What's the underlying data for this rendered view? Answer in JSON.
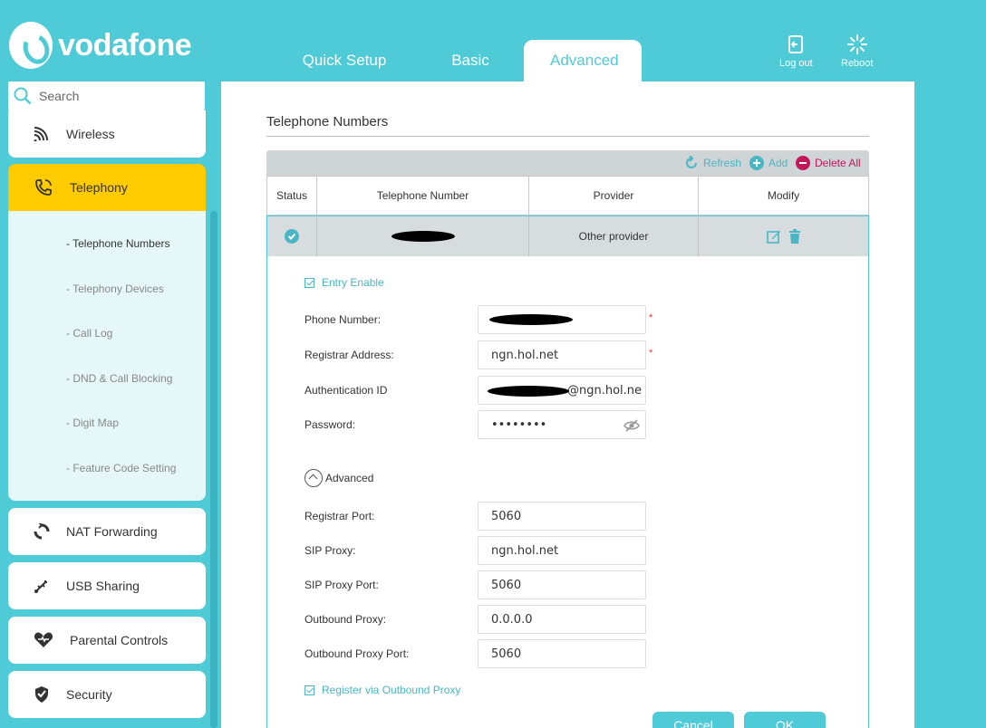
{
  "brand": {
    "name": "vodafone"
  },
  "tabs": [
    {
      "label": "Quick Setup"
    },
    {
      "label": "Basic"
    },
    {
      "label": "Advanced"
    }
  ],
  "top_actions": {
    "logout": "Log out",
    "reboot": "Reboot"
  },
  "search": {
    "placeholder": "Search"
  },
  "sidebar": {
    "items": [
      {
        "label": "Wireless",
        "icon": "wifi-icon"
      },
      {
        "label": "Telephony",
        "icon": "phone-icon",
        "active": true
      },
      {
        "label": "NAT Forwarding",
        "icon": "nat-icon"
      },
      {
        "label": "USB Sharing",
        "icon": "usb-icon"
      },
      {
        "label": "Parental Controls",
        "icon": "heart-icon"
      },
      {
        "label": "Security",
        "icon": "shield-icon"
      }
    ],
    "submenu": [
      "- Telephone Numbers",
      "- Telephony Devices",
      "- Call Log",
      "- DND & Call Blocking",
      "- Digit Map",
      "- Feature Code Setting"
    ]
  },
  "section": {
    "title": "Telephone Numbers"
  },
  "toolbar": {
    "refresh": "Refresh",
    "add": "Add",
    "delete_all": "Delete All"
  },
  "table": {
    "headers": [
      "Status",
      "Telephone Number",
      "Provider",
      "Modify"
    ],
    "row": {
      "provider": "Other provider"
    }
  },
  "form": {
    "entry_enable": "Entry Enable",
    "phone_number_label": "Phone Number:",
    "registrar_address_label": "Registrar Address:",
    "registrar_address": "ngn.hol.net",
    "auth_id_label": "Authentication ID",
    "auth_id_suffix": "@ngn.hol.ne",
    "password_label": "Password:",
    "password": "••••••••",
    "required_mark": "*",
    "advanced_label": "Advanced",
    "registrar_port_label": "Registrar Port:",
    "registrar_port": "5060",
    "sip_proxy_label": "SIP Proxy:",
    "sip_proxy": "ngn.hol.net",
    "sip_proxy_port_label": "SIP Proxy Port:",
    "sip_proxy_port": "5060",
    "outbound_proxy_label": "Outbound Proxy:",
    "outbound_proxy": "0.0.0.0",
    "outbound_proxy_port_label": "Outbound Proxy Port:",
    "outbound_proxy_port": "5060",
    "register_via_outbound": "Register via Outbound Proxy"
  },
  "buttons": {
    "cancel": "Cancel",
    "ok": "OK"
  },
  "colors": {
    "accent": "#4ecbd7",
    "active_nav": "#fdcb00",
    "delete": "#c2185b"
  }
}
